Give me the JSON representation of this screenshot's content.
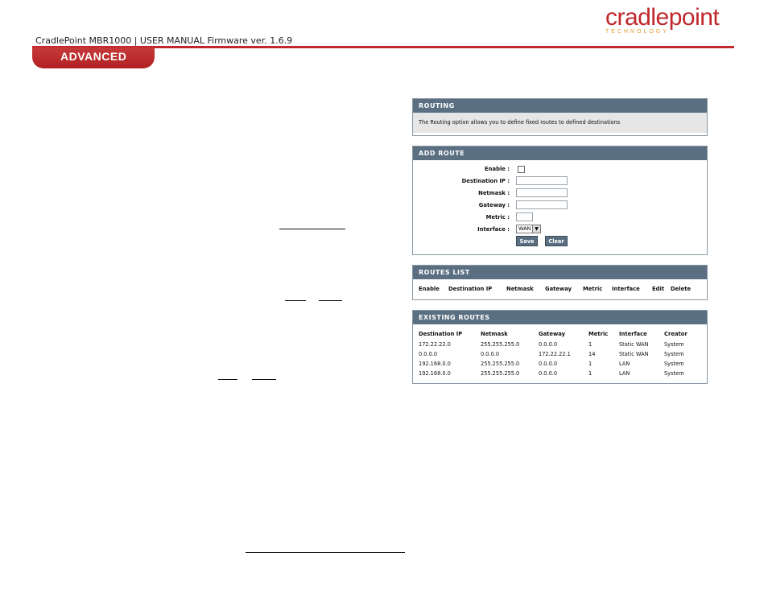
{
  "header": {
    "doc_title": "CradlePoint MBR1000 | USER MANUAL Firmware ver. 1.6.9",
    "logo_word": "cradlepoint",
    "logo_sub": "TECHNOLOGY",
    "section": "ADVANCED",
    "accent_color": "#c0282d"
  },
  "routing": {
    "title": "ROUTING",
    "description": "The Routing option allows you to define fixed routes to defined destinations"
  },
  "add_route": {
    "title": "ADD ROUTE",
    "enable_label": "Enable :",
    "destination_label": "Destination IP :",
    "destination_value": "",
    "netmask_label": "Netmask :",
    "netmask_value": "",
    "gateway_label": "Gateway :",
    "gateway_value": "",
    "metric_label": "Metric :",
    "metric_value": "",
    "interface_label": "Interface :",
    "interface_value": "WAN",
    "save_label": "Save",
    "clear_label": "Clear"
  },
  "routes_list": {
    "title": "ROUTES LIST",
    "columns": [
      "Enable",
      "Destination IP",
      "Netmask",
      "Gateway",
      "Metric",
      "Interface",
      "Edit",
      "Delete"
    ]
  },
  "existing_routes": {
    "title": "EXISTING ROUTES",
    "columns": [
      "Destination IP",
      "Netmask",
      "Gateway",
      "Metric",
      "Interface",
      "Creator"
    ],
    "rows": [
      [
        "172.22.22.0",
        "255.255.255.0",
        "0.0.0.0",
        "1",
        "Static WAN",
        "System"
      ],
      [
        "0.0.0.0",
        "0.0.0.0",
        "172.22.22.1",
        "14",
        "Static WAN",
        "System"
      ],
      [
        "192.168.0.0",
        "255.255.255.0",
        "0.0.0.0",
        "1",
        "LAN",
        "System"
      ],
      [
        "192.168.0.0",
        "255.255.255.0",
        "0.0.0.0",
        "1",
        "LAN",
        "System"
      ]
    ]
  }
}
